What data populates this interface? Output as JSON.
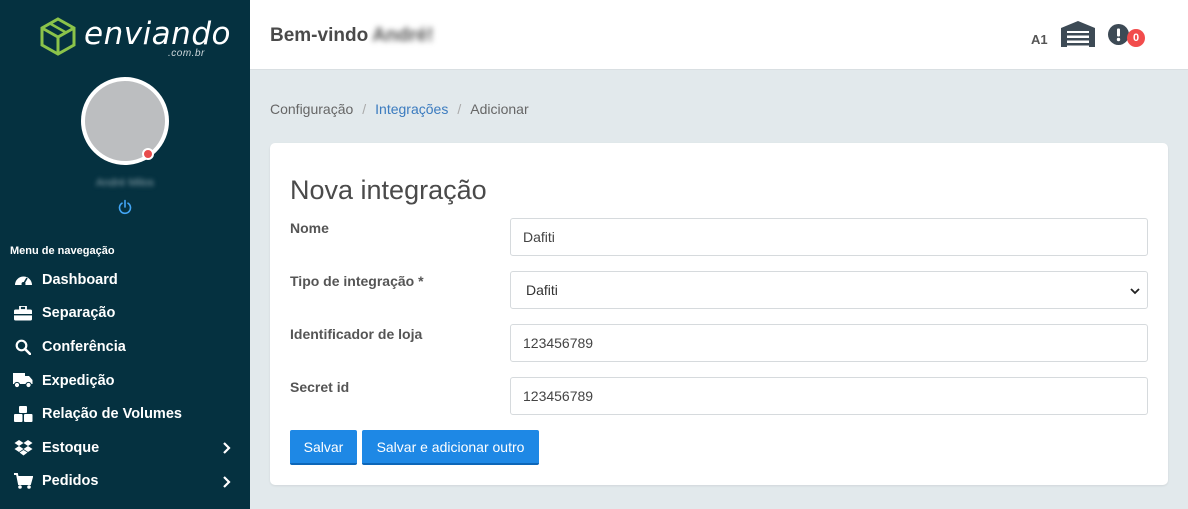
{
  "brand": {
    "name": "enviando",
    "domain": ".com.br",
    "accent": "#8bc34a"
  },
  "sidebar": {
    "user_name": "André Milos",
    "nav_title": "Menu de navegação",
    "items": [
      {
        "label": "Dashboard",
        "icon": "gauge-icon"
      },
      {
        "label": "Separação",
        "icon": "toolbox-icon"
      },
      {
        "label": "Conferência",
        "icon": "search-icon"
      },
      {
        "label": "Expedição",
        "icon": "truck-icon"
      },
      {
        "label": "Relação de Volumes",
        "icon": "boxes-icon"
      },
      {
        "label": "Estoque",
        "icon": "dropbox-icon",
        "submenu": true
      },
      {
        "label": "Pedidos",
        "icon": "cart-icon",
        "submenu": true
      }
    ]
  },
  "header": {
    "welcome": "Bem-vindo",
    "user_first_name": "André!",
    "store_code": "A1",
    "alert_count": "0"
  },
  "breadcrumb": {
    "items": [
      "Configuração",
      "Integrações",
      "Adicionar"
    ]
  },
  "form": {
    "title": "Nova integração",
    "fields": [
      {
        "label": "Nome",
        "value": "Dafiti"
      },
      {
        "label": "Tipo de integração *",
        "value": "Dafiti"
      },
      {
        "label": "Identificador de loja",
        "value": "123456789"
      },
      {
        "label": "Secret id",
        "value": "123456789"
      }
    ],
    "save_label": "Salvar",
    "save_add_label": "Salvar e adicionar outro"
  },
  "colors": {
    "sidebar_bg": "#053140",
    "primary": "#1e88e5",
    "badge": "#f24c4c"
  }
}
